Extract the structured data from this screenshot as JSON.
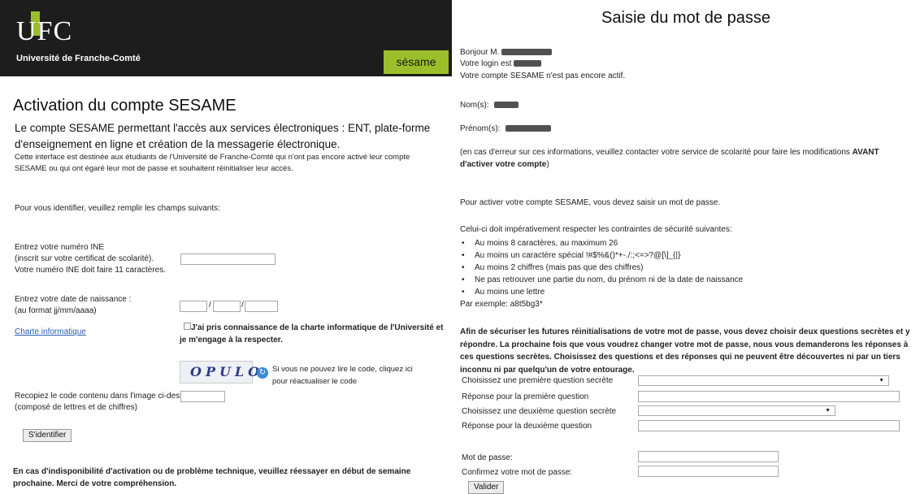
{
  "left": {
    "logo_text": "UFC",
    "university": "Université de Franche-Comté",
    "badge": "sésame",
    "title": "Activation du compte SESAME",
    "subtitle": "Le compte SESAME permettant l'accès aux services électroniques : ENT, plate-forme d'enseignement en ligne et création de la messagerie électronique.",
    "description": "Cette interface est destinée aux étudiants de l'Université de Franche-Comté qui n'ont pas encore activé leur compte SESAME ou qui ont égaré leur mot de passe et souhaitent réinitialiser leur accès.",
    "identify_prompt": "Pour vous identifier, veuillez remplir les champs suivants:",
    "ine_label_1": "Entrez votre numéro INE",
    "ine_label_2": "(inscrit sur votre certificat de scolarité).",
    "ine_label_3": "Votre numéro INE doit faire 11 caractères.",
    "ine_value": "",
    "birth_label_1": "Entrez votre date de naissance :",
    "birth_label_2": "(au format jj/mm/aaaa)",
    "birth_day": "",
    "birth_month": "",
    "birth_year": "",
    "slash": "/",
    "charte_link": "Charte informatique",
    "charte_checked": false,
    "charte_text": "J'ai pris connaissance de la charte informatique de l'Université et je m'engage à la respecter.",
    "captcha_text": "OPULO",
    "captcha_help": "Si vous ne pouvez lire le code, cliquez ici pour réactualiser le code",
    "code_label_1": "Recopiez le code contenu dans l'image ci-dessus :",
    "code_label_2": "(composé de lettres et de chiffres)",
    "code_value": "",
    "submit_label": "S'identifier",
    "footer": "En cas d'indisponibilité d'activation ou de problème technique, veuillez réessayer en début de semaine prochaine. Merci de votre compréhension."
  },
  "right": {
    "title": "Saisie du mot de passe",
    "greeting": "Bonjour M.",
    "login_label": "Votre login est",
    "inactive": "Votre compte SESAME n'est pas encore actif.",
    "nom_label": "Nom(s):",
    "prenom_label": "Prénom(s):",
    "error_note_pre": "(en cas d'erreur sur ces informations, veuillez contacter votre service de scolarité pour faire les modifications ",
    "error_note_bold": "AVANT d'activer votre compte",
    "error_note_post": ")",
    "activate_info": "Pour activer votre compte SESAME, vous devez saisir un mot de passe.",
    "constraints_intro": "Celui-ci doit impérativement respecter les contraintes de sécurité suivantes:",
    "constraints": [
      "Au moins 8 caractères, au maximum 26",
      "Au moins un caractère spécial !#$%&()*+-./:;<=>?@[\\]_{|}",
      "Au moins 2 chiffres (mais pas que des chiffres)",
      "Ne pas retrouver une partie du nom, du prénom ni de la date de naissance",
      "Au moins une lettre"
    ],
    "example": "Par exemple: a8t5bg3*",
    "secure_text": "Afin de sécuriser les futures réinitialisations de votre mot de passe, vous devez choisir deux questions secrètes et y répondre. La prochaine fois que vous voudrez changer votre mot de passe, nous vous demanderons les réponses à ces questions secrètes. Choisissez des questions et des réponses qui ne peuvent être découvertes ni par un tiers inconnu ni par quelqu'un de votre entourage.",
    "q1_label": "Choisissez une première question secrète",
    "q1_value": "",
    "a1_label": "Réponse pour la première question",
    "a1_value": "",
    "q2_label": "Choisissez une deuxième question secrète",
    "q2_value": "",
    "a2_label": "Réponse pour la deuxième question",
    "a2_value": "",
    "pwd_label": "Mot de passe:",
    "pwd_confirm_label": "Confirmez votre mot de passe:",
    "submit_label": "Valider",
    "redaction_color": "#333333"
  }
}
